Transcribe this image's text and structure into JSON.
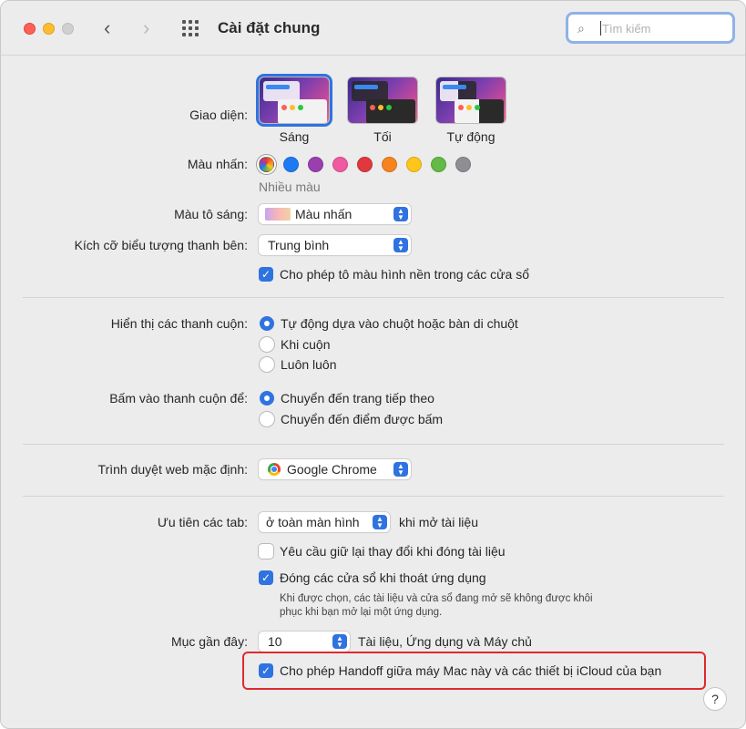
{
  "window": {
    "title": "Cài đặt chung"
  },
  "toolbar": {
    "back": "‹",
    "forward": "›",
    "search_placeholder": "Tìm kiếm"
  },
  "appearance": {
    "label": "Giao diện:",
    "options": [
      "Sáng",
      "Tối",
      "Tự động"
    ],
    "selected": "Sáng"
  },
  "accent": {
    "label": "Màu nhấn:",
    "caption": "Nhiều màu",
    "colors": [
      "multicolor",
      "#1d7af3",
      "#9a3fb0",
      "#ef5aa0",
      "#e0383e",
      "#f7831f",
      "#fdc61b",
      "#63ba46",
      "#8e8e93"
    ]
  },
  "highlight": {
    "label": "Màu tô sáng:",
    "value": "Màu nhấn"
  },
  "sidebar_icon": {
    "label": "Kích cỡ biểu tượng thanh bên:",
    "value": "Trung bình"
  },
  "wallpaper_tint": {
    "label": "Cho phép tô màu hình nền trong các cửa sổ",
    "checked": true
  },
  "scrollbars": {
    "label": "Hiển thị các thanh cuộn:",
    "options": [
      "Tự động dựa vào chuột hoặc bàn di chuột",
      "Khi cuộn",
      "Luôn luôn"
    ],
    "selected": 0
  },
  "scroll_click": {
    "label": "Bấm vào thanh cuộn để:",
    "options": [
      "Chuyển đến trang tiếp theo",
      "Chuyển đến điểm được bấm"
    ],
    "selected": 0
  },
  "browser": {
    "label": "Trình duyệt web mặc định:",
    "value": "Google Chrome"
  },
  "tabs": {
    "label": "Ưu tiên các tab:",
    "value": "ở toàn màn hình",
    "suffix": "khi mở tài liệu"
  },
  "ask_keep_changes": {
    "label": "Yêu cầu giữ lại thay đổi khi đóng tài liệu",
    "checked": false
  },
  "close_windows": {
    "label": "Đóng các cửa sổ khi thoát ứng dụng",
    "checked": true,
    "note_line1": "Khi được chọn, các tài liệu và cửa sổ đang mở sẽ không được khôi",
    "note_line2": "phục khi bạn mở lại một ứng dụng."
  },
  "recent": {
    "label": "Mục gần đây:",
    "value": "10",
    "suffix": "Tài liệu, Ứng dụng và Máy chủ"
  },
  "handoff": {
    "label": "Cho phép Handoff giữa máy Mac này và các thiết bị iCloud của bạn",
    "checked": true
  },
  "help": {
    "label": "?"
  }
}
